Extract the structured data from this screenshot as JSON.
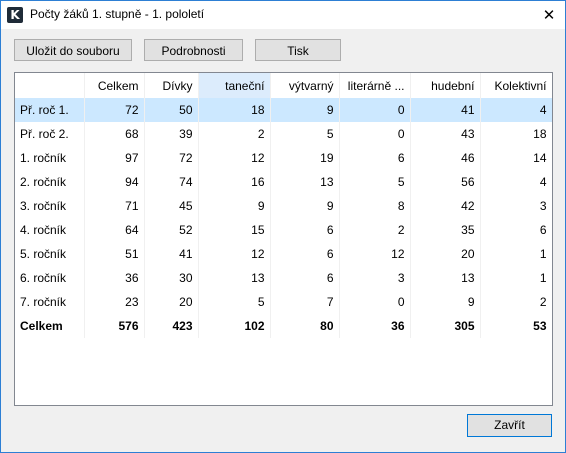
{
  "window": {
    "title": "Počty žáků 1. stupně - 1. pololetí",
    "app_icon_glyph": "K",
    "close_glyph": "✕"
  },
  "toolbar": {
    "save_label": "Uložit do souboru",
    "details_label": "Podrobnosti",
    "print_label": "Tisk"
  },
  "table": {
    "columns": [
      "",
      "Celkem",
      "Dívky",
      "taneční",
      "výtvarný",
      "literárně ...",
      "hudební",
      "Kolektivní"
    ],
    "rows": [
      [
        "Př. roč 1.",
        "72",
        "50",
        "18",
        "9",
        "0",
        "41",
        "4"
      ],
      [
        "Př. roč 2.",
        "68",
        "39",
        "2",
        "5",
        "0",
        "43",
        "18"
      ],
      [
        "1. ročník",
        "97",
        "72",
        "12",
        "19",
        "6",
        "46",
        "14"
      ],
      [
        "2. ročník",
        "94",
        "74",
        "16",
        "13",
        "5",
        "56",
        "4"
      ],
      [
        "3. ročník",
        "71",
        "45",
        "9",
        "9",
        "8",
        "42",
        "3"
      ],
      [
        "4. ročník",
        "64",
        "52",
        "15",
        "6",
        "2",
        "35",
        "6"
      ],
      [
        "5. ročník",
        "51",
        "41",
        "12",
        "6",
        "12",
        "20",
        "1"
      ],
      [
        "6. ročník",
        "36",
        "30",
        "13",
        "6",
        "3",
        "13",
        "1"
      ],
      [
        "7. ročník",
        "23",
        "20",
        "5",
        "7",
        "0",
        "9",
        "2"
      ]
    ],
    "total": [
      "Celkem",
      "576",
      "423",
      "102",
      "80",
      "36",
      "305",
      "53"
    ]
  },
  "footer": {
    "close_label": "Zavřít"
  },
  "colors": {
    "selected_row": "#cce8ff",
    "highlighted_header": "#dcecfc",
    "window_border": "#2d7fd4"
  }
}
